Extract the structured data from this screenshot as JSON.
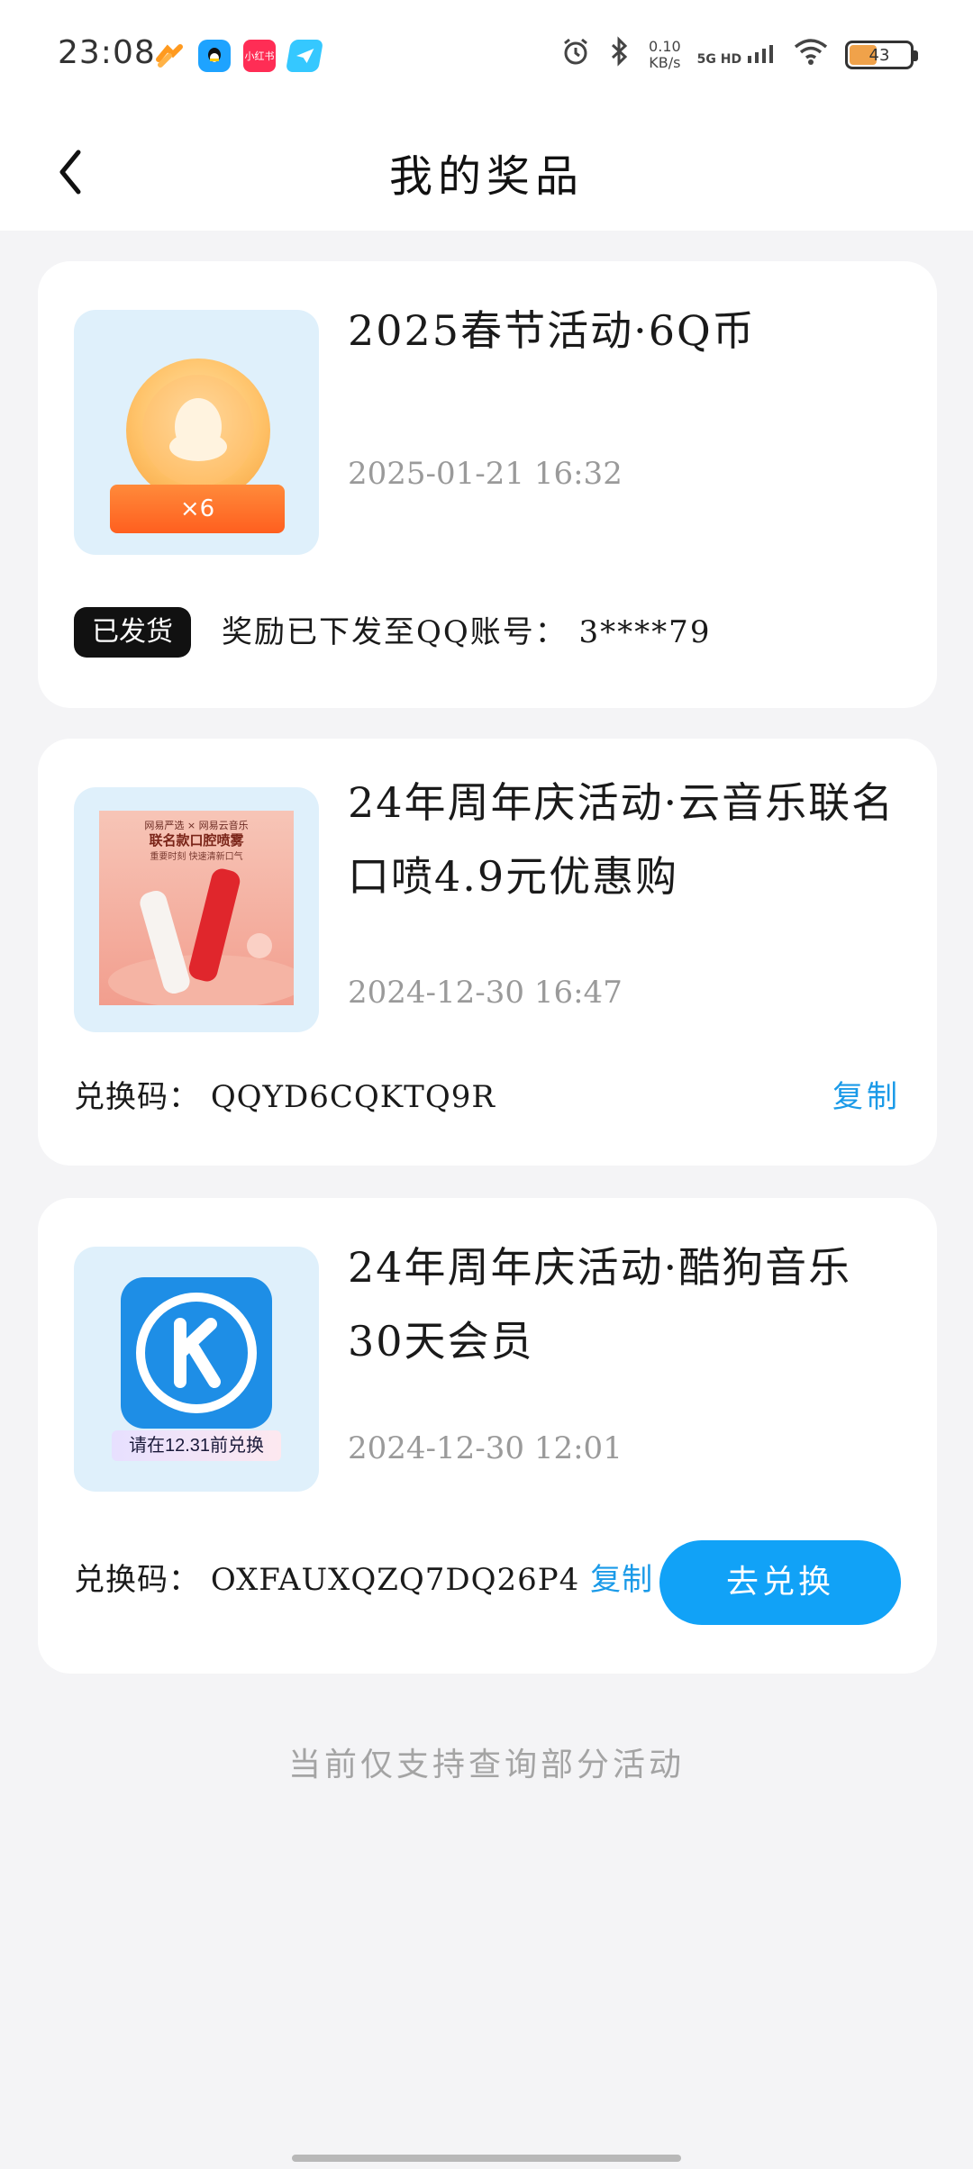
{
  "status_bar": {
    "time": "23:08",
    "notification_icons": [
      "orange-app-icon",
      "qq-icon",
      "xiaohongshu-icon",
      "telegram-icon"
    ],
    "xiaohongshu_label": "小红书",
    "net_speed_value": "0.10",
    "net_speed_unit": "KB/s",
    "signal_label": "5G HD",
    "battery_level": "43",
    "battery_fraction": 0.43
  },
  "header": {
    "title": "我的奖品"
  },
  "prizes": [
    {
      "title": "2025春节活动·6Q币",
      "date": "2025-01-21 16:32",
      "thumb_badge": "×6",
      "status_chip": "已发货",
      "delivery_text": "奖励已下发至QQ账号： 3****79"
    },
    {
      "title": "24年周年庆活动·云音乐联名口喷4.9元优惠购",
      "date": "2024-12-30 16:47",
      "thumb_header": "网易严选 × 网易云音乐",
      "thumb_title": "联名款口腔喷雾",
      "thumb_sub": "重要时刻 快速清新口气",
      "code_label": "兑换码：",
      "code": "QQYD6CQKTQ9R",
      "copy_label": "复制"
    },
    {
      "title": "24年周年庆活动·酷狗音乐30天会员",
      "date": "2024-12-30 12:01",
      "thumb_tag": "请在12.31前兑换",
      "code_label": "兑换码：",
      "code": "OXFAUXQZQ7DQ26P4",
      "copy_label": "复制",
      "redeem_label": "去兑换"
    }
  ],
  "footer": {
    "note": "当前仅支持查询部分活动"
  },
  "colors": {
    "accent": "#11a2f7",
    "link": "#1a9ae8",
    "background": "#f4f4f6",
    "card": "#ffffff",
    "thumb_bg": "#dff0fb"
  }
}
